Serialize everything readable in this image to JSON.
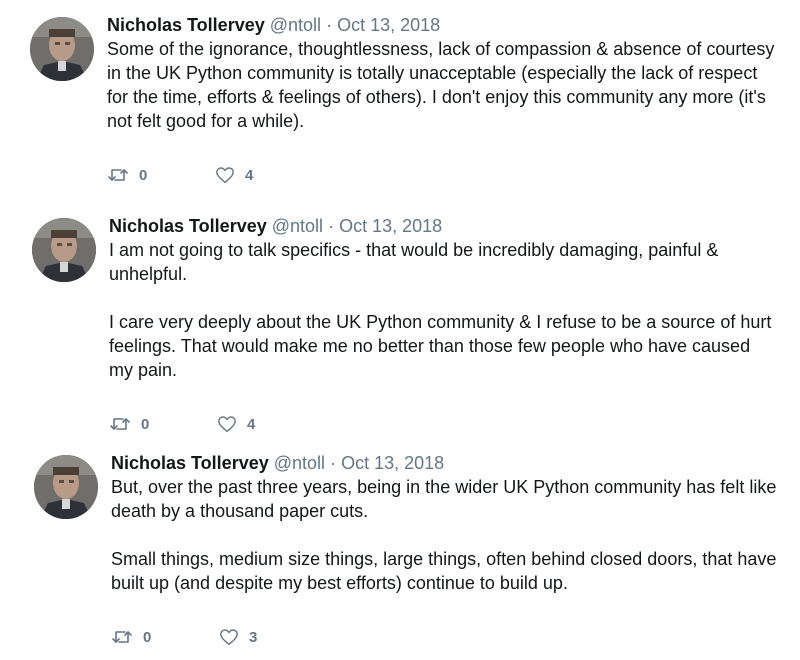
{
  "colors": {
    "name": "#14171a",
    "muted": "#657786",
    "icon": "#657786"
  },
  "icons": {
    "retweet": "retweet-icon",
    "like": "heart-icon"
  },
  "tweets": [
    {
      "name": "Nicholas Tollervey",
      "handle": "@ntoll",
      "separator": "·",
      "date": "Oct 13, 2018",
      "paragraphs": [
        "Some of the ignorance, thoughtlessness, lack of compassion & absence of courtesy in the UK Python community is totally unacceptable (especially the lack of respect for the time, efforts & feelings of others). I don't enjoy this community any more (it's not felt good for a while)."
      ],
      "retweets": "0",
      "likes": "4"
    },
    {
      "name": "Nicholas Tollervey",
      "handle": "@ntoll",
      "separator": "·",
      "date": "Oct 13, 2018",
      "paragraphs": [
        "I am not going to talk specifics - that would be incredibly damaging, painful & unhelpful.",
        "I care very deeply about the UK Python community & I refuse to be a source of hurt feelings. That would make me no better than those few people who have caused my pain."
      ],
      "retweets": "0",
      "likes": "4"
    },
    {
      "name": "Nicholas Tollervey",
      "handle": "@ntoll",
      "separator": "·",
      "date": "Oct 13, 2018",
      "paragraphs": [
        "But, over the past three years, being in the wider UK Python community has felt like death by a thousand paper cuts.",
        "Small things, medium size things, large things, often behind closed doors, that have built up (and despite my best  efforts) continue to build up."
      ],
      "retweets": "0",
      "likes": "3"
    }
  ]
}
